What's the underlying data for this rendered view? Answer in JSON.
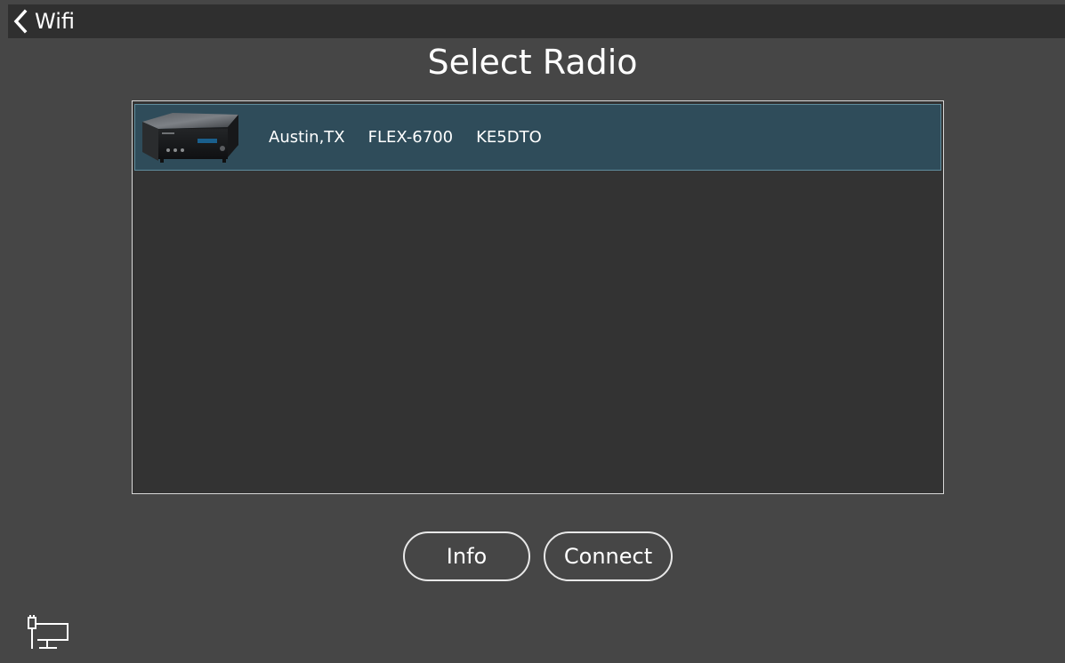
{
  "nav": {
    "back_label": "Wifi"
  },
  "page": {
    "title": "Select Radio"
  },
  "radios": [
    {
      "location": "Austin,TX",
      "model": "FLEX-6700",
      "callsign": "KE5DTO",
      "selected": true
    }
  ],
  "buttons": {
    "info_label": "Info",
    "connect_label": "Connect"
  },
  "icons": {
    "back": "chevron-left-icon",
    "radio_device": "radio-device-image",
    "network": "network-computer-icon"
  },
  "colors": {
    "background": "#464646",
    "topbar": "#2f2f2f",
    "list_background": "#333333",
    "selected_row": "#2f4c5a",
    "selected_row_border": "#5f8c9c",
    "text": "#ffffff"
  }
}
